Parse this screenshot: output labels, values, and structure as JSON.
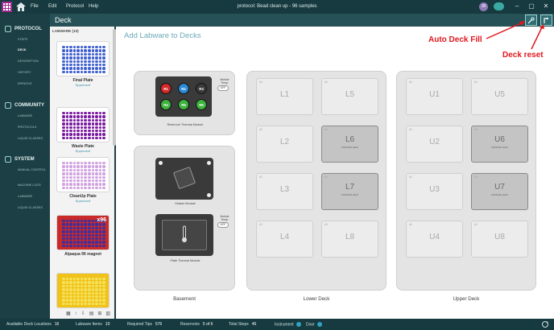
{
  "window": {
    "title": "protocol: Bead clean up - 96  samples",
    "menu": [
      "File",
      "Edit",
      "Protocol",
      "Help"
    ],
    "user_initials": "JB",
    "controls": [
      "–",
      "▢",
      "✕"
    ]
  },
  "header": {
    "title": "Deck"
  },
  "sidebar": {
    "sections": [
      {
        "label": "PROTOCOL",
        "icon": "edit-icon",
        "items": [
          "STEPS",
          "DECK",
          "DESCRIPTION",
          "HISTORY",
          "ERRATUS"
        ]
      },
      {
        "label": "COMMUNITY",
        "icon": "community-icon",
        "items": [
          "LABWARE",
          "PROTOCOLS",
          "LIQUID CLASSES"
        ]
      },
      {
        "label": "SYSTEM",
        "icon": "wrench-icon",
        "items": [
          "MANUAL CONTROL",
          "MACHINE LOGS",
          "LABWARE",
          "LIQUID CLASSES"
        ]
      }
    ],
    "active": "DECK"
  },
  "labware": {
    "header": "LABWARE (10)",
    "items": [
      {
        "name": "Final Plate",
        "vendor": "Eppendorf",
        "well_color": "#3f5fcf",
        "bg": "#ffffff"
      },
      {
        "name": "Waste Plate",
        "vendor": "Eppendorf",
        "well_color": "#7a1aa0",
        "bg": "#ffffff"
      },
      {
        "name": "CleanUp Plate",
        "vendor": "Eppendorf",
        "well_color": "#d0a2e0",
        "bg": "#ffffff"
      },
      {
        "name": "Alpaqua 96 magnet",
        "vendor": "",
        "badge": "x96",
        "well_color": "#3a2fa0",
        "bg": "#c92a2a"
      },
      {
        "name": "",
        "vendor": "",
        "well_color": "#f5e25a",
        "bg": "#f1c21a"
      }
    ],
    "tools": [
      "▦",
      "↑",
      "⇩",
      "▤",
      "⊞",
      "▥"
    ]
  },
  "main": {
    "title": "Add Labware to Decks",
    "basement": {
      "label": "Basement",
      "reservoir_module": {
        "label": "Reservoir Thermal Module",
        "temp_label": "Module Temp:",
        "toggle": "OFF",
        "reservoirs": [
          {
            "name": "R1",
            "color": "#d22a2a"
          },
          {
            "name": "R2",
            "color": "#2a8ad6"
          },
          {
            "name": "R3",
            "color": "#3a3a3a"
          },
          {
            "name": "R4",
            "color": "#3db33d"
          },
          {
            "name": "R5",
            "color": "#3db33d"
          },
          {
            "name": "R6",
            "color": "#3db33d"
          }
        ]
      },
      "shaker_module": {
        "label": "Shaker Module"
      },
      "plate_module": {
        "label": "Plate Thermal Module",
        "temp_label": "Module Temp:",
        "toggle": "OFF"
      }
    },
    "lower_deck": {
      "label": "Lower Deck",
      "slots": [
        {
          "name": "L1",
          "corner": "A1",
          "occupied": false,
          "sub": ""
        },
        {
          "name": "L5",
          "corner": "A1",
          "occupied": false,
          "sub": ""
        },
        {
          "name": "L2",
          "corner": "A1",
          "occupied": false,
          "sub": ""
        },
        {
          "name": "L6",
          "corner": "A1",
          "occupied": true,
          "sub": "DISPENSE HEAD"
        },
        {
          "name": "L3",
          "corner": "A1",
          "occupied": false,
          "sub": ""
        },
        {
          "name": "L7",
          "corner": "A1",
          "occupied": true,
          "sub": "DISPENSE HEAD"
        },
        {
          "name": "L4",
          "corner": "A1",
          "occupied": false,
          "sub": ""
        },
        {
          "name": "L8",
          "corner": "A1",
          "occupied": false,
          "sub": ""
        }
      ]
    },
    "upper_deck": {
      "label": "Upper Deck",
      "slots": [
        {
          "name": "U1",
          "corner": "A1",
          "occupied": false,
          "sub": ""
        },
        {
          "name": "U5",
          "corner": "A1",
          "occupied": false,
          "sub": ""
        },
        {
          "name": "U2",
          "corner": "A1",
          "occupied": false,
          "sub": ""
        },
        {
          "name": "U6",
          "corner": "A1",
          "occupied": true,
          "sub": "DISPENSE HEAD"
        },
        {
          "name": "U3",
          "corner": "A1",
          "occupied": false,
          "sub": ""
        },
        {
          "name": "U7",
          "corner": "A1",
          "occupied": true,
          "sub": "DISPENSE HEAD"
        },
        {
          "name": "U4",
          "corner": "A1",
          "occupied": false,
          "sub": ""
        },
        {
          "name": "U8",
          "corner": "A1",
          "occupied": false,
          "sub": ""
        }
      ]
    }
  },
  "status": {
    "available_deck_label": "Available Deck Locations",
    "available_deck": "16",
    "labware_items_label": "Labware Items",
    "labware_items": "10",
    "required_tips_label": "Required Tips",
    "required_tips": "576",
    "reservoirs_label": "Reservoirs",
    "reservoirs": "5 of 6",
    "total_steps_label": "Total Steps",
    "total_steps": "46",
    "instrument_label": "Instrument",
    "door_label": "Door"
  },
  "annotations": {
    "auto_fill": "Auto Deck Fill",
    "reset": "Deck reset",
    "color": "#e0181f"
  }
}
